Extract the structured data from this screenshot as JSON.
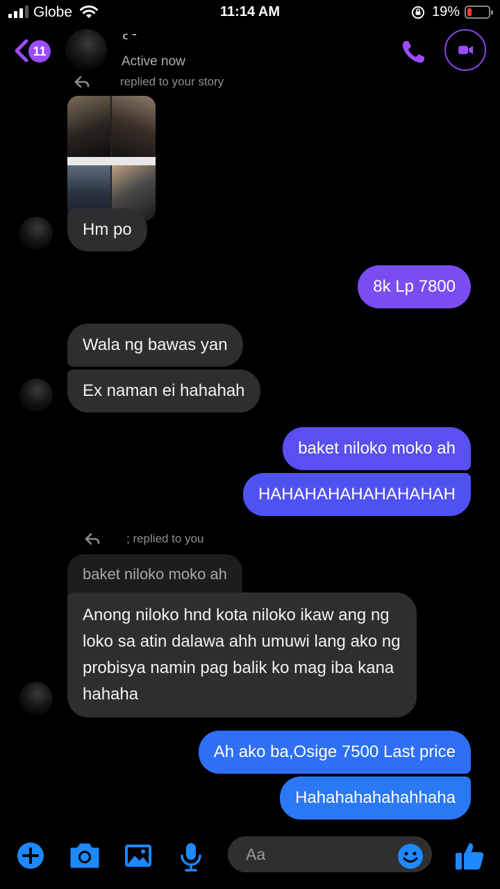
{
  "status": {
    "carrier": "Globe",
    "time": "11:14 AM",
    "battery_percent": "19%",
    "battery_level": 0.19,
    "signal_bars": 3
  },
  "header": {
    "back_badge": "11",
    "contact_name": "ᑦ  ˉ",
    "presence": "Active now",
    "accent_color": "#9b4dff"
  },
  "thread": {
    "story_reply_label": "replied to your story",
    "msg_hm": "Hm po",
    "msg_8k": "8k Lp 7800",
    "msg_wala": "Wala ng bawas yan",
    "msg_ex": "Ex naman ei hahahah",
    "msg_baket": "baket niloko moko ah",
    "msg_haha": "HAHAHAHAHAHAHAHAH",
    "reply_label": "; replied to you",
    "quoted_text": "baket niloko moko ah",
    "msg_anong": "Anong niloko hnd kota niloko ikaw ang ng loko sa atin dalawa ahh umuwi lang ako ng probisya namin pag balik ko mag iba kana hahaha",
    "msg_ahako": "Ah ako ba,Osige 7500 Last price",
    "msg_hahaha2": "Hahahahahahahhaha"
  },
  "composer": {
    "placeholder": "Aa",
    "icons": [
      "plus-icon",
      "camera-icon",
      "gallery-icon",
      "microphone-icon",
      "emoji-icon",
      "thumbs-up-icon"
    ],
    "icon_color": "#1e88ff"
  }
}
